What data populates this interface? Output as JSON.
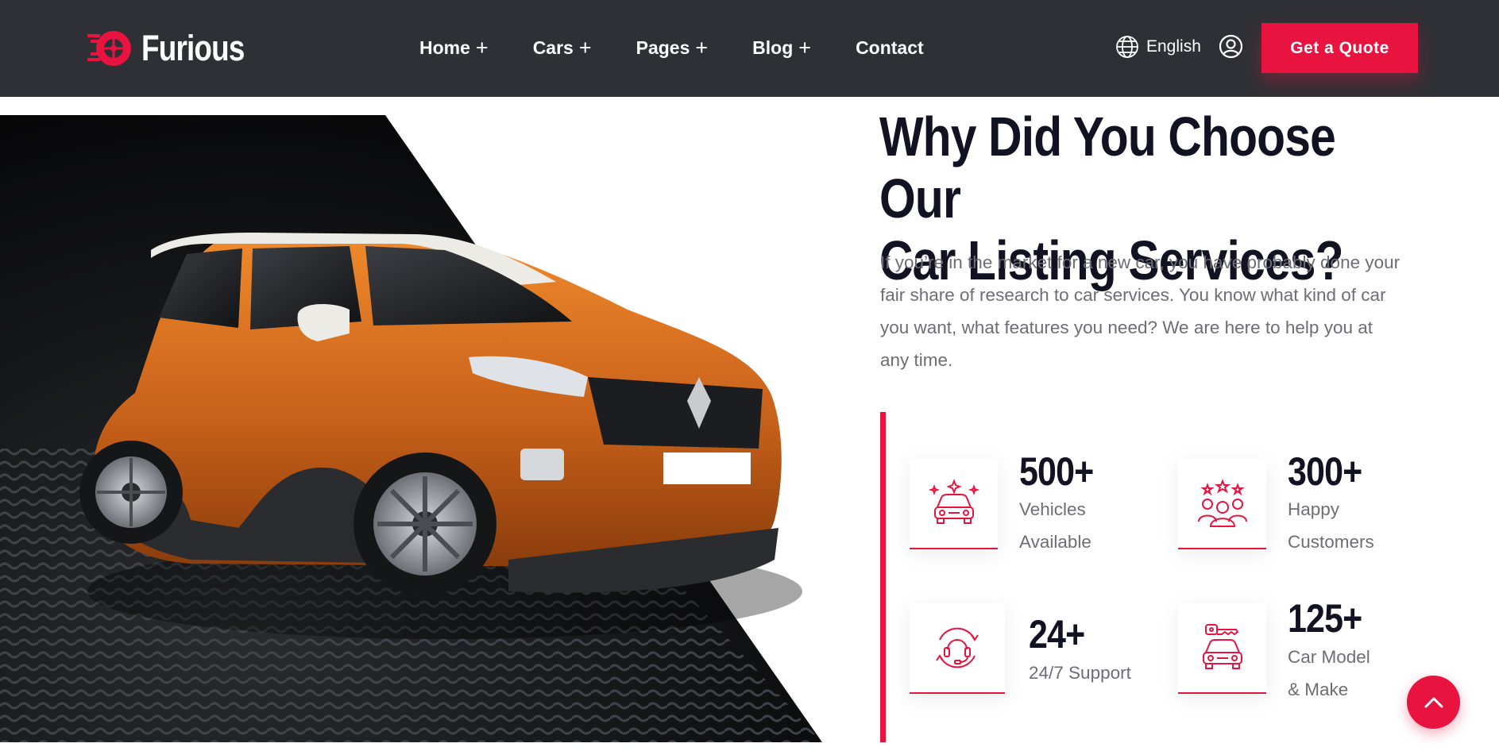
{
  "brand": {
    "name": "Furious",
    "accent": "#e8133f",
    "header_bg": "#2f3035"
  },
  "nav": {
    "items": [
      {
        "label": "Home",
        "plus": "+"
      },
      {
        "label": "Cars",
        "plus": "+"
      },
      {
        "label": "Pages",
        "plus": "+"
      },
      {
        "label": "Blog",
        "plus": "+"
      },
      {
        "label": "Contact",
        "plus": ""
      }
    ],
    "language": "English",
    "user_icon": "user-circle-icon",
    "cta": "Get a Quote"
  },
  "section": {
    "title_line1": "Why Did You Choose Our",
    "title_line2": "Car Listing Services?",
    "description": "If you’re in the market for a new car, you have probably done your fair share of research to car services. You know what kind of car you want, what features you need? We are here to help you at any time."
  },
  "stats": [
    {
      "value": "500+",
      "label": "Vehicles Available",
      "icon": "car-sparkle-icon"
    },
    {
      "value": "300+",
      "label": "Happy Customers",
      "icon": "customers-stars-icon"
    },
    {
      "value": "24+",
      "label": "24/7 Support",
      "icon": "headset-support-icon"
    },
    {
      "value": "125+",
      "label": "Car Model & Make",
      "icon": "car-key-icon"
    }
  ],
  "scroll_top_icon": "chevron-up-icon"
}
